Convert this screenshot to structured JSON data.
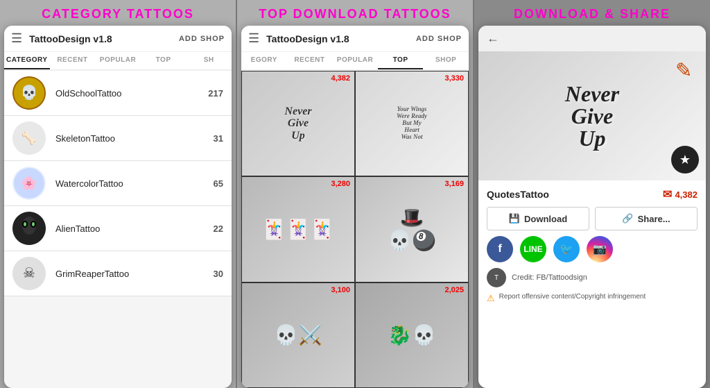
{
  "panels": [
    {
      "id": "panel1",
      "title": "CATEGORY  TATTOOS",
      "appBar": {
        "title": "TattooDesign v1.8",
        "addShopLabel": "ADD SHOP"
      },
      "tabs": [
        {
          "label": "CATEGORY",
          "active": true
        },
        {
          "label": "RECENT",
          "active": false
        },
        {
          "label": "POPULAR",
          "active": false
        },
        {
          "label": "TOP",
          "active": false
        },
        {
          "label": "SH",
          "active": false
        }
      ],
      "categories": [
        {
          "name": "OldSchoolTattoo",
          "count": "217",
          "thumbClass": "thumb-oldschool"
        },
        {
          "name": "SkeletonTattoo",
          "count": "31",
          "thumbClass": "thumb-skeleton"
        },
        {
          "name": "WatercolorTattoo",
          "count": "65",
          "thumbClass": "thumb-watercolor"
        },
        {
          "name": "AlienTattoo",
          "count": "22",
          "thumbClass": "thumb-alien"
        },
        {
          "name": "GrimReaperTattoo",
          "count": "30",
          "thumbClass": "thumb-grimreaper"
        }
      ]
    },
    {
      "id": "panel2",
      "title": "TOP DOWNLOAD  TATTOOS",
      "appBar": {
        "title": "TattooDesign v1.8",
        "addShopLabel": "ADD SHOP"
      },
      "tabs": [
        {
          "label": "EGORY",
          "active": false
        },
        {
          "label": "RECENT",
          "active": false
        },
        {
          "label": "POPULAR",
          "active": false
        },
        {
          "label": "TOP",
          "active": true
        },
        {
          "label": "SHOP",
          "active": false
        }
      ],
      "gridItems": [
        {
          "count": "4,382",
          "bgClass": "tattoo-bg-1",
          "text": "Never\nGive\nUp",
          "type": "text"
        },
        {
          "count": "3,330",
          "bgClass": "tattoo-bg-2",
          "text": "Your Wings\nWere Ready\nBut My\nHeart\nWas Not",
          "type": "text"
        },
        {
          "count": "3,280",
          "bgClass": "tattoo-bg-3",
          "text": "🃏🃏🃏",
          "type": "icon"
        },
        {
          "count": "3,169",
          "bgClass": "tattoo-bg-4",
          "text": "🎩💀",
          "type": "icon"
        },
        {
          "count": "3,100",
          "bgClass": "tattoo-bg-5",
          "text": "💀⚔️",
          "type": "icon"
        },
        {
          "count": "2,025",
          "bgClass": "tattoo-bg-6",
          "text": "🐉💀",
          "type": "icon"
        }
      ]
    },
    {
      "id": "panel3",
      "title": "DOWNLOAD & SHARE",
      "backLabel": "←",
      "mainTattooText": "Never\nGive\nUp",
      "favIcon": "★",
      "itemTitle": "QuotesTattoo",
      "downloadCount": "4,382",
      "downloadLabel": "Download",
      "shareLabel": "Share...",
      "socialButtons": [
        {
          "label": "f",
          "class": "social-fb",
          "name": "facebook"
        },
        {
          "label": "L",
          "class": "social-line",
          "name": "line"
        },
        {
          "label": "t",
          "class": "social-tw",
          "name": "twitter"
        },
        {
          "label": "📷",
          "class": "social-ig",
          "name": "instagram"
        }
      ],
      "creditText": "Credit: FB/Tattoodsign",
      "reportText": "Report offensive content/Copyright infringement"
    }
  ]
}
